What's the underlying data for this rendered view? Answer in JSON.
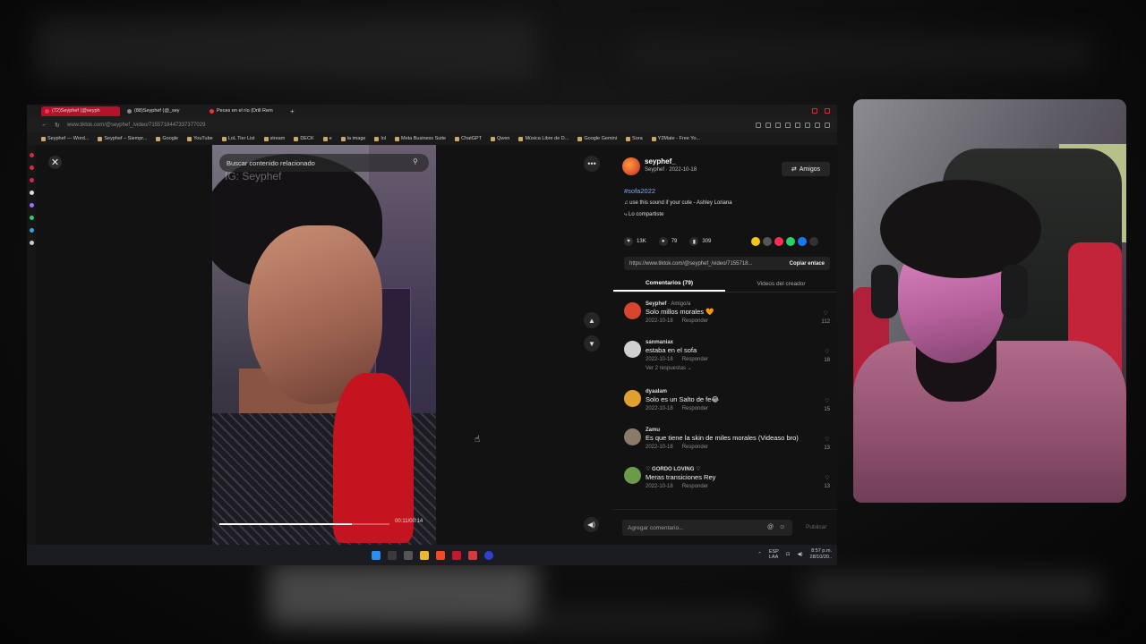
{
  "browser": {
    "tabs": [
      {
        "label": "(72)Seyphef (@seyph",
        "active": true
      },
      {
        "label": "(88)Seyphef (@_sey",
        "active": false
      },
      {
        "label": "Peces en el río (Drill Rem",
        "active": false
      }
    ],
    "new_tab": "+",
    "url": "www.tiktok.com/@seyphef_/video/7155718447337377029",
    "bookmarks": [
      "Seyphef — Word...",
      "Seyphef – Siempr...",
      "Google",
      "YouTube",
      "LoL Tier List",
      "stream",
      "DECK",
      "e",
      "la image",
      "lol",
      "Meta Business Suite",
      "ChatGPT",
      "Qwen",
      "Música Libre de D...",
      "Google Gemini",
      "Sora",
      "Y2Mate - Free Yo..."
    ]
  },
  "video": {
    "search_placeholder": "Buscar contenido relacionado",
    "watermark": "IG: Seyphef",
    "time": "00:11/00:14",
    "progress": 0.78
  },
  "controls": {
    "close": "✕",
    "more": "•••",
    "up": "▲",
    "down": "▼",
    "volume": "◀)"
  },
  "post": {
    "username": "seyphef_",
    "meta": "Seyphef · 2022-10-18",
    "friends_label": "Amigos",
    "hashtag": "#sofa2022",
    "sound": "♫  use this sound if your cute - Ashley Loriana",
    "shared": "⤷ Lo compartiste",
    "likes": "13K",
    "comments": "79",
    "saves": "309",
    "link": "https://www.tiktok.com/@seyphef_/video/7155718...",
    "copy_label": "Copiar enlace",
    "tab_comments": "Comentarios (79)",
    "tab_videos": "Videos del creador"
  },
  "comments": [
    {
      "user": "Seyphef",
      "tag": " · Amigo/a",
      "text": "Solo millos morales 🧡",
      "date": "2022-10-18",
      "reply": "Responder",
      "likes": "112",
      "avatar": "#d8452f"
    },
    {
      "user": "sanmaniax",
      "tag": "",
      "text": "estaba en el sofa",
      "date": "2022-10-18",
      "reply": "Responder",
      "likes": "18",
      "avatar": "#d0d0d0",
      "more": "Ver 2 respuestas ⌄"
    },
    {
      "user": "dyaalam",
      "tag": "",
      "text": "Solo es un Salto de fe😂",
      "date": "2022-10-18",
      "reply": "Responder",
      "likes": "15",
      "avatar": "#e0a030"
    },
    {
      "user": "Zamu",
      "tag": "",
      "text": "Es que tiene la skin de miles morales (Videaso bro)",
      "date": "2022-10-18",
      "reply": "Responder",
      "likes": "13",
      "avatar": "#8a7a6a"
    },
    {
      "user": "♡ GORDO LOVING ♡",
      "tag": "",
      "text": "Meras transiciones Rey",
      "date": "2022-10-18",
      "reply": "Responder",
      "likes": "13",
      "avatar": "#6a9a4a"
    }
  ],
  "compose": {
    "placeholder": "Agregar comentario...",
    "at": "@",
    "emoji": "☺",
    "publish": "Publicar"
  },
  "taskbar": {
    "lang": "ESP\nLAA",
    "time": "8:57 p.m.",
    "date": "28/10/20.."
  }
}
